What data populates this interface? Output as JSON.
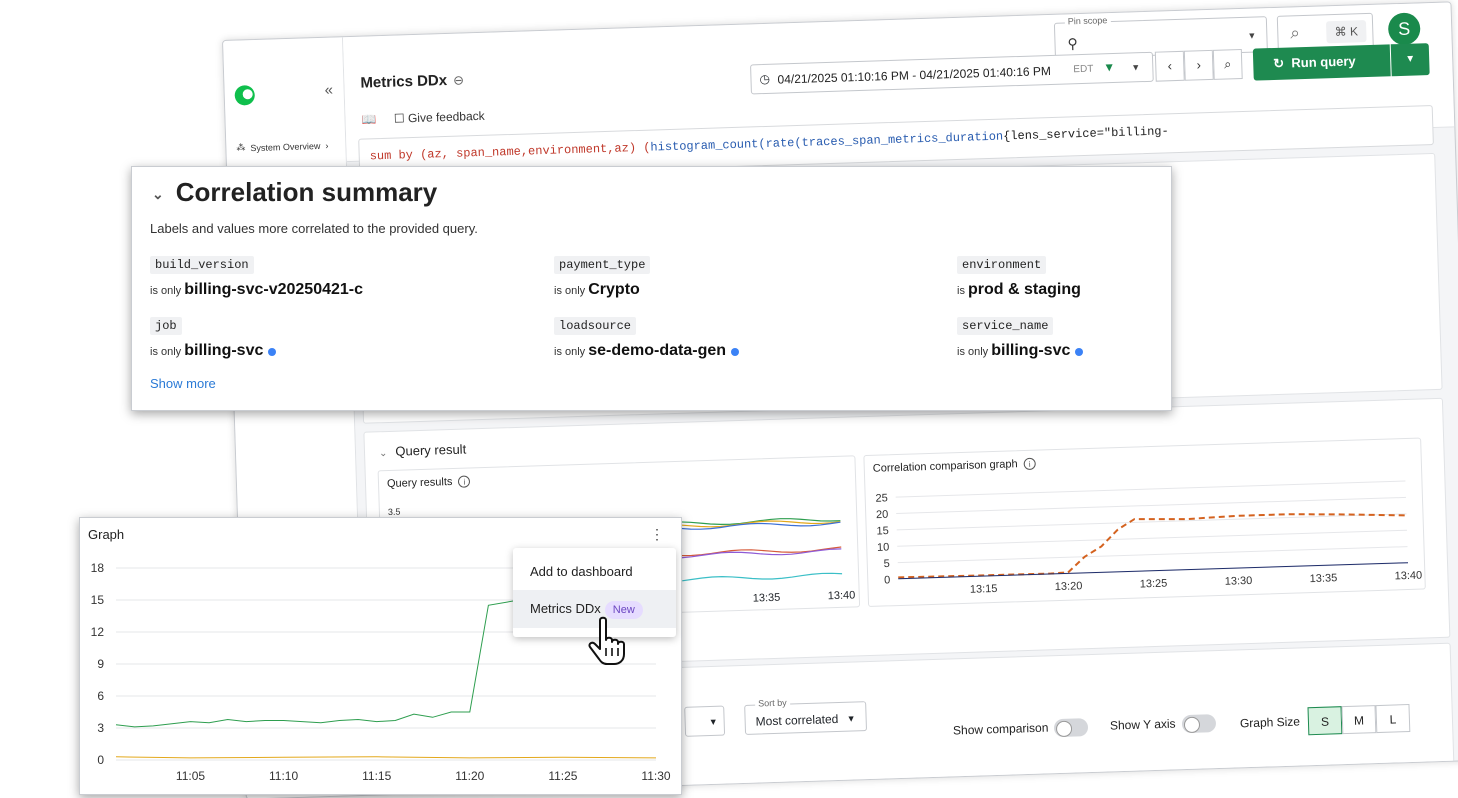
{
  "app": {
    "title": "Metrics DDx",
    "sidebar": {
      "collapse_label": "«",
      "items": [
        {
          "label": "System Overview",
          "chevron": "›"
        }
      ]
    },
    "pin_scope": {
      "label": "Pin scope",
      "icon": "telescope-icon"
    },
    "search": {
      "shortcut": "⌘ K"
    },
    "avatar_initial": "S",
    "time_range": {
      "value": "04/21/2025 01:10:16 PM - 04/21/2025 01:40:16 PM",
      "timezone": "EDT"
    },
    "run_query_label": "Run query",
    "give_feedback_label": "Give feedback",
    "query": {
      "line1": [
        {
          "t": "sum by (az, span_name,environment,az) (",
          "c": "q-red"
        },
        {
          "t": "histogram_count(",
          "c": "q-blue"
        },
        {
          "t": "rate(",
          "c": "q-blue"
        },
        {
          "t": "traces_span_metrics_duration",
          "c": "q-blue"
        },
        {
          "t": "{lens_service=\"billing-",
          "c": "q-dark"
        }
      ]
    },
    "query_result": {
      "header": "Query result",
      "chart1": {
        "title": "Query results",
        "y_top": "3.5",
        "x_ticks": [
          "13:35",
          "13:40"
        ]
      },
      "chart2": {
        "title": "Correlation comparison graph"
      }
    },
    "controls": {
      "sort_by": {
        "label": "Sort by",
        "value": "Most correlated"
      },
      "show_comparison": "Show comparison",
      "show_y_axis": "Show Y axis",
      "graph_size": "Graph Size",
      "sizes": [
        "S",
        "M",
        "L"
      ],
      "active_size": "S"
    }
  },
  "correlation": {
    "title": "Correlation summary",
    "subtitle": "Labels and values more correlated to the provided query.",
    "items": [
      {
        "key": "build_version",
        "prefix": "is only",
        "value": "billing-svc-v20250421-c",
        "dot": false
      },
      {
        "key": "payment_type",
        "prefix": "is only",
        "value": "Crypto",
        "dot": false
      },
      {
        "key": "environment",
        "prefix": "is",
        "value": "prod & staging",
        "dot": false
      },
      {
        "key": "job",
        "prefix": "is only",
        "value": "billing-svc",
        "dot": true
      },
      {
        "key": "loadsource",
        "prefix": "is only",
        "value": "se-demo-data-gen",
        "dot": true
      },
      {
        "key": "service_name",
        "prefix": "is only",
        "value": "billing-svc",
        "dot": true
      }
    ],
    "show_more": "Show more"
  },
  "graph": {
    "title": "Graph",
    "menu": [
      {
        "label": "Add to dashboard"
      },
      {
        "label": "Metrics DDx",
        "badge": "New"
      }
    ]
  },
  "chart_data": [
    {
      "type": "line",
      "title": "Graph",
      "x": [
        "11:05",
        "11:10",
        "11:15",
        "11:20",
        "11:25",
        "11:30"
      ],
      "ylim": [
        0,
        18
      ],
      "yticks": [
        0,
        3,
        6,
        9,
        12,
        15,
        18
      ],
      "x_start": "11:01",
      "series": [
        {
          "color": "#2e9e4f",
          "points": [
            [
              "11:01",
              3.3
            ],
            [
              "11:02",
              3.1
            ],
            [
              "11:03",
              3.2
            ],
            [
              "11:04",
              3.4
            ],
            [
              "11:05",
              3.6
            ],
            [
              "11:06",
              3.5
            ],
            [
              "11:07",
              3.8
            ],
            [
              "11:08",
              3.6
            ],
            [
              "11:09",
              3.7
            ],
            [
              "11:10",
              3.7
            ],
            [
              "11:11",
              3.6
            ],
            [
              "11:12",
              3.5
            ],
            [
              "11:13",
              3.7
            ],
            [
              "11:14",
              3.8
            ],
            [
              "11:15",
              3.6
            ],
            [
              "11:16",
              3.7
            ],
            [
              "11:17",
              4.3
            ],
            [
              "11:18",
              4.0
            ],
            [
              "11:19",
              4.5
            ],
            [
              "11:20",
              4.5
            ],
            [
              "11:21",
              14.5
            ],
            [
              "11:22",
              14.8
            ],
            [
              "11:23",
              15.1
            ]
          ]
        },
        {
          "color": "#e3a81b",
          "points": [
            [
              "11:01",
              0.3
            ],
            [
              "11:05",
              0.2
            ],
            [
              "11:10",
              0.25
            ],
            [
              "11:15",
              0.3
            ],
            [
              "11:20",
              0.2
            ],
            [
              "11:25",
              0.25
            ],
            [
              "11:30",
              0.2
            ]
          ]
        }
      ]
    },
    {
      "type": "line",
      "title": "Correlation comparison graph",
      "x": [
        "13:15",
        "13:20",
        "13:25",
        "13:30",
        "13:35",
        "13:40"
      ],
      "ylim": [
        0,
        25
      ],
      "yticks": [
        0,
        5,
        10,
        15,
        20,
        25
      ],
      "x_start": "13:10",
      "series": [
        {
          "color": "#d4621f",
          "dashed": true,
          "points": [
            [
              "13:10",
              0.5
            ],
            [
              "13:15",
              0.3
            ],
            [
              "13:19",
              0.2
            ],
            [
              "13:20",
              0.4
            ],
            [
              "13:21",
              5
            ],
            [
              "13:22",
              8
            ],
            [
              "13:23",
              13
            ],
            [
              "13:24",
              16
            ],
            [
              "13:27",
              15.5
            ],
            [
              "13:30",
              16
            ],
            [
              "13:33",
              16
            ],
            [
              "13:36",
              15.5
            ],
            [
              "13:38",
              15
            ],
            [
              "13:40",
              14.5
            ]
          ]
        },
        {
          "color": "#1f2d6b",
          "points": [
            [
              "13:10",
              0.1
            ],
            [
              "13:40",
              0.1
            ]
          ]
        }
      ]
    }
  ]
}
